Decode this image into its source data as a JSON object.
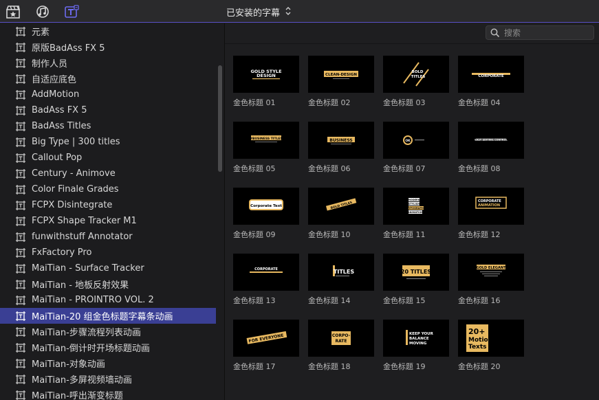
{
  "toolbar": {
    "icons": [
      "clapper-star-icon",
      "music-notes-icon",
      "titles-icon"
    ],
    "browser_title": "已安装的字幕"
  },
  "search": {
    "placeholder": "搜索",
    "value": ""
  },
  "sidebar": {
    "items": [
      {
        "label": "元素"
      },
      {
        "label": "原版BadAss FX 5"
      },
      {
        "label": "制作人员"
      },
      {
        "label": "自适应底色"
      },
      {
        "label": "AddMotion"
      },
      {
        "label": "BadAss FX 5"
      },
      {
        "label": "BadAss Titles"
      },
      {
        "label": "Big Type | 300 titles"
      },
      {
        "label": "Callout Pop"
      },
      {
        "label": "Century - Animove"
      },
      {
        "label": "Color Finale Grades"
      },
      {
        "label": "FCPX Disintegrate"
      },
      {
        "label": "FCPX Shape Tracker M1"
      },
      {
        "label": "funwithstuff Annotator"
      },
      {
        "label": "FxFactory Pro"
      },
      {
        "label": "MaiTian -  Surface Tracker"
      },
      {
        "label": "MaiTian - 地板反射效果"
      },
      {
        "label": "MaiTian - PROINTRO VOL. 2"
      },
      {
        "label": "MaiTian-20 组金色标题字幕条动画",
        "selected": true
      },
      {
        "label": "MaiTian-步骤流程列表动画"
      },
      {
        "label": "MaiTian-倒计时开场标题动画"
      },
      {
        "label": "MaiTian-对象动画"
      },
      {
        "label": "MaiTian-多屏视频墙动画"
      },
      {
        "label": "MaiTian-呼出渐变标题"
      }
    ]
  },
  "grid": {
    "accent": "#e8b960",
    "tiles": [
      {
        "label": "金色标题 01",
        "thumb_text": [
          "GOLD STYLE",
          "DESIGN"
        ]
      },
      {
        "label": "金色标题 02",
        "thumb_text": [
          "CLEAN-DESIGN"
        ]
      },
      {
        "label": "金色标题 03",
        "thumb_text": [
          "BOLD",
          "TITLES"
        ]
      },
      {
        "label": "金色标题 04",
        "thumb_text": [
          "CORPORATE"
        ]
      },
      {
        "label": "金色标题 05",
        "thumb_text": [
          "#BUSINESS TITLES"
        ]
      },
      {
        "label": "金色标题 06",
        "thumb_text": [
          "BUSINESS"
        ]
      },
      {
        "label": "金色标题 07",
        "thumb_text": [
          "OK"
        ]
      },
      {
        "label": "金色标题 08",
        "thumb_text": [
          "EASY EDITING CONTROL"
        ]
      },
      {
        "label": "金色标题 09",
        "thumb_text": [
          "Corporate Text"
        ]
      },
      {
        "label": "金色标题 10",
        "thumb_text": [
          "BOLD TITLES"
        ]
      },
      {
        "label": "金色标题 11",
        "thumb_text": [
          "MODERN",
          "STYLISH",
          "TYPOGRAPHY",
          "ANIMATION"
        ]
      },
      {
        "label": "金色标题 12",
        "thumb_text": [
          "CORPORATE",
          "ANIMATION"
        ]
      },
      {
        "label": "金色标题 13",
        "thumb_text": [
          "CORPORATE"
        ]
      },
      {
        "label": "金色标题 14",
        "thumb_text": [
          "TITLES"
        ]
      },
      {
        "label": "金色标题 15",
        "thumb_text": [
          "20 TITLES"
        ]
      },
      {
        "label": "金色标题 16",
        "thumb_text": [
          "GOLD ELEGANT"
        ]
      },
      {
        "label": "金色标题 17",
        "thumb_text": [
          "FOR EVERYONE"
        ]
      },
      {
        "label": "金色标题 18",
        "thumb_text": [
          "CORPO-",
          "RATE"
        ]
      },
      {
        "label": "金色标题 19",
        "thumb_text": [
          "KEEP YOUR",
          "BALANCE",
          "MOVING"
        ]
      },
      {
        "label": "金色标题 20",
        "thumb_text": [
          "20+",
          "Motion",
          "Texts"
        ]
      }
    ]
  }
}
